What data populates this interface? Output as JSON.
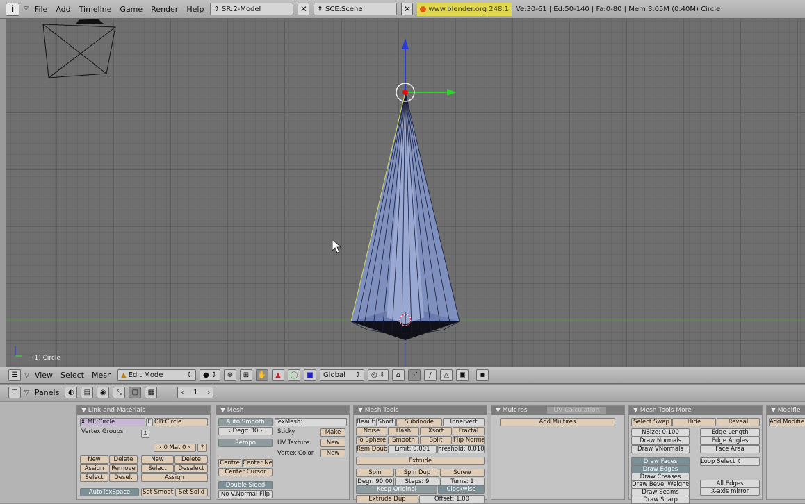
{
  "topbar": {
    "logo": "i",
    "menus": [
      "File",
      "Add",
      "Timeline",
      "Game",
      "Render",
      "Help"
    ],
    "screen": "SR:2-Model",
    "scene": "SCE:Scene",
    "website": "www.blender.org 248.1",
    "stats": "Ve:30-61 | Ed:50-140 | Fa:0-80 | Mem:3.05M (0.40M) Circle"
  },
  "viewport": {
    "object_label": "(1) Circle"
  },
  "view_header": {
    "menus": [
      "View",
      "Select",
      "Mesh"
    ],
    "mode": "Edit Mode",
    "orientation": "Global"
  },
  "buttons_header": {
    "label": "Panels",
    "frame": "1"
  },
  "link_materials": {
    "title": "Link and Materials",
    "mesh_name": "ME:Circle",
    "f": "F",
    "ob_name": "OB:Circle",
    "vertex_groups": "Vertex Groups",
    "mat_counter": "0 Mat 0",
    "q": "?",
    "new": "New",
    "delete": "Delete",
    "assign": "Assign",
    "remove": "Remove",
    "select": "Select",
    "desel": "Desel.",
    "new2": "New",
    "delete2": "Delete",
    "select2": "Select",
    "deselect": "Deselect",
    "assign2": "Assign",
    "autotexspace": "AutoTexSpace",
    "set_smooth": "Set Smoot",
    "set_solid": "Set Solid"
  },
  "mesh": {
    "title": "Mesh",
    "auto_smooth": "Auto Smooth",
    "degr": "Degr: 30",
    "retopo": "Retopo",
    "texmesh": "TexMesh:",
    "sticky": "Sticky",
    "make": "Make",
    "uv_texture": "UV Texture",
    "new1": "New",
    "vertex_color": "Vertex Color",
    "new2": "New",
    "centre": "Centre",
    "center_new": "Center Ne",
    "center_cursor": "Center Cursor",
    "double_sided": "Double Sided",
    "no_vnormal_flip": "No V.Normal Flip"
  },
  "mesh_tools": {
    "title": "Mesh Tools",
    "beauty": "Beauty",
    "short": "Short",
    "subdivide": "Subdivide",
    "innervert": "Innervert",
    "noise": "Noise",
    "hash": "Hash",
    "xsort": "Xsort",
    "fractal": "Fractal",
    "to_sphere": "To Sphere",
    "smooth": "Smooth",
    "split": "Split",
    "flip_normals": "Flip Norma",
    "rem_doubles": "Rem Doub",
    "limit": "Limit: 0.001",
    "threshold": "hreshold: 0.010",
    "extrude": "Extrude",
    "spin": "Spin",
    "spin_dup": "Spin Dup",
    "screw": "Screw",
    "degr": "Degr: 90.00",
    "steps": "Steps: 9",
    "turns": "Turns: 1",
    "keep_original": "Keep Original",
    "clockwise": "Clockwise",
    "extrude_dup": "Extrude Dup",
    "offset": "Offset: 1.00"
  },
  "multires": {
    "tab1": "Multires",
    "tab2": "UV Calculation",
    "add_multires": "Add Multires"
  },
  "mesh_tools_more": {
    "title": "Mesh Tools More",
    "select_swap": "Select Swap",
    "hide": "Hide",
    "reveal": "Reveal",
    "nsize": "NSize: 0.100",
    "draw_normals": "Draw Normals",
    "draw_vnormals": "Draw VNormals",
    "edge_length": "Edge Length",
    "edge_angles": "Edge Angles",
    "face_area": "Face Area",
    "draw_faces": "Draw Faces",
    "draw_edges": "Draw Edges",
    "draw_creases": "Draw Creases",
    "draw_bevel": "Draw Bevel Weights",
    "draw_seams": "Draw Seams",
    "draw_sharp": "Draw Sharp",
    "loop_select": "Loop Select",
    "all_edges": "All Edges",
    "x_mirror": "X-axis mirror"
  },
  "modifiers": {
    "title": "Modifie",
    "add": "Add Modifie"
  },
  "colors": {
    "accent": "#e0d850",
    "mesh": "#7f8fbe"
  }
}
